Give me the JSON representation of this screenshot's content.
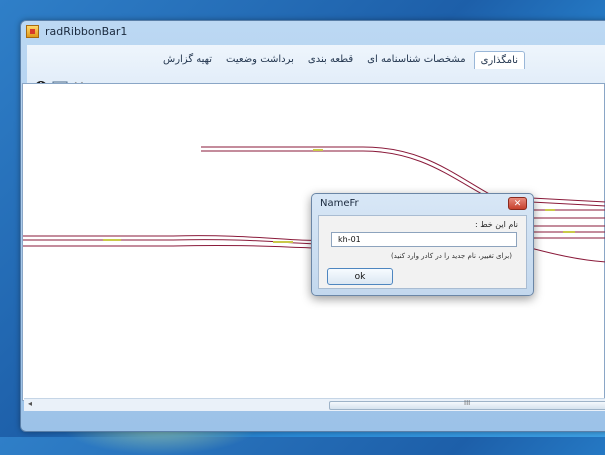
{
  "window": {
    "title": "radRibbonBar1"
  },
  "ribbon": {
    "tabs": [
      {
        "label": "نامگذاری",
        "active": true
      },
      {
        "label": "مشخصات شناسنامه ای",
        "active": false
      },
      {
        "label": "قطعه بندی",
        "active": false
      },
      {
        "label": "برداشت وضعیت",
        "active": false
      },
      {
        "label": "تهیه گزارش",
        "active": false
      }
    ],
    "toolbar": {
      "info_glyph": "i",
      "close_glyph": "✕"
    }
  },
  "scrollbar": {
    "left_arrow": "◂",
    "grip": "III"
  },
  "dialog": {
    "title": "NameFr",
    "close_glyph": "✕",
    "prompt": "نام این خط :",
    "value": "kh-01",
    "hint": "(برای تغییر، نام جدید را در کادر وارد کنید)",
    "ok_label": "ok"
  },
  "colors": {
    "line": "#8a1a3a",
    "accent": "#c9c948",
    "window_frame": "#9cc2e8"
  }
}
